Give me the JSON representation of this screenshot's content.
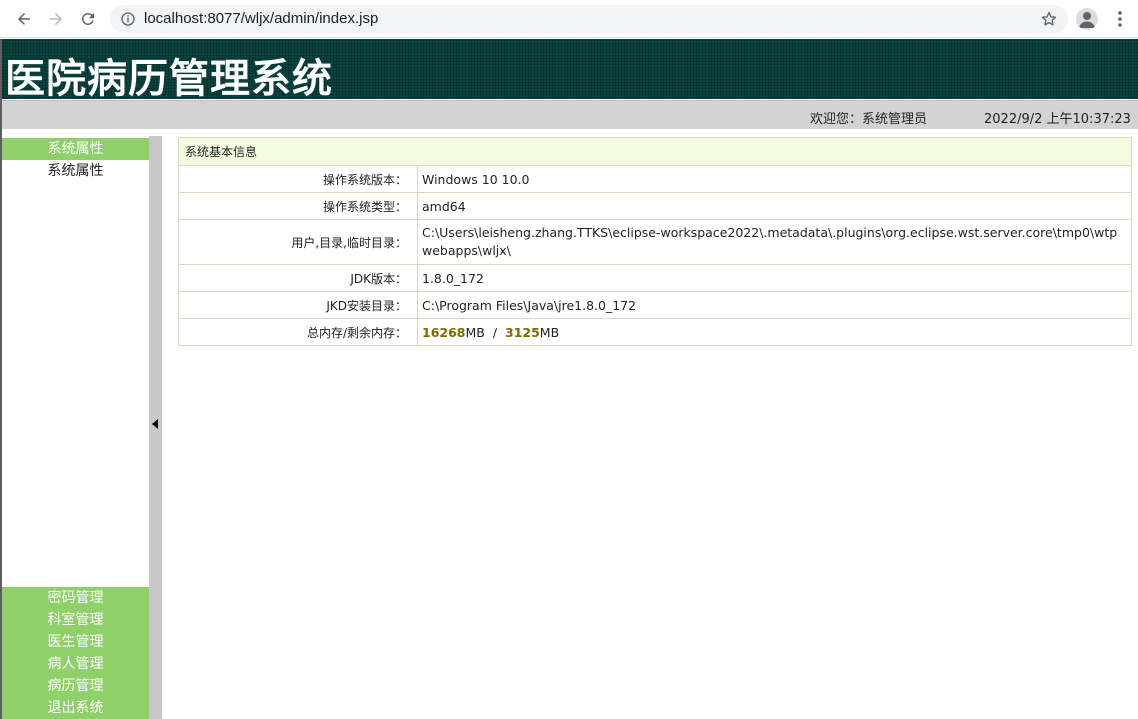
{
  "browser": {
    "url": "localhost:8077/wljx/admin/index.jsp",
    "icons": [
      "back-icon",
      "forward-icon",
      "reload-icon",
      "info-icon",
      "star-icon",
      "avatar-icon",
      "menu-dots-icon"
    ]
  },
  "header": {
    "title": "医院病历管理系统",
    "welcome": "欢迎您：系统管理员",
    "datetime": "2022/9/2 上午10:37:23"
  },
  "sidebar": {
    "group": "系统属性",
    "sub_item": "系统属性",
    "bottom_items": [
      "密码管理",
      "科室管理",
      "医生管理",
      "病人管理",
      "病历管理",
      "退出系统"
    ]
  },
  "info": {
    "heading": "系统基本信息",
    "rows": [
      {
        "label": "操作系统版本：",
        "value": "Windows 10  10.0"
      },
      {
        "label": "操作系统类型：",
        "value": "amd64"
      },
      {
        "label": "用户,目录,临时目录：",
        "value": "C:\\Users\\leisheng.zhang.TTKS\\eclipse-workspace2022\\.metadata\\.plugins\\org.eclipse.wst.server.core\\tmp0\\wtpwebapps\\wljx\\"
      },
      {
        "label": "JDK版本：",
        "value": "1.8.0_172"
      },
      {
        "label": "JKD安装目录：",
        "value": "C:\\Program Files\\Java\\jre1.8.0_172"
      },
      {
        "label": "总内存/剩余内存："
      }
    ],
    "memory": {
      "total": "16268",
      "total_unit": "MB",
      "separator": "/",
      "free": "3125",
      "free_unit": "MB"
    }
  },
  "colors": {
    "header_bg": "#0a4440",
    "menu_green": "#8fd06a",
    "status_bar": "#d3d3d3",
    "table_head_bg": "#f4fcdf",
    "table_border": "#d2dcc0",
    "memory_number": "#7a6a00"
  }
}
